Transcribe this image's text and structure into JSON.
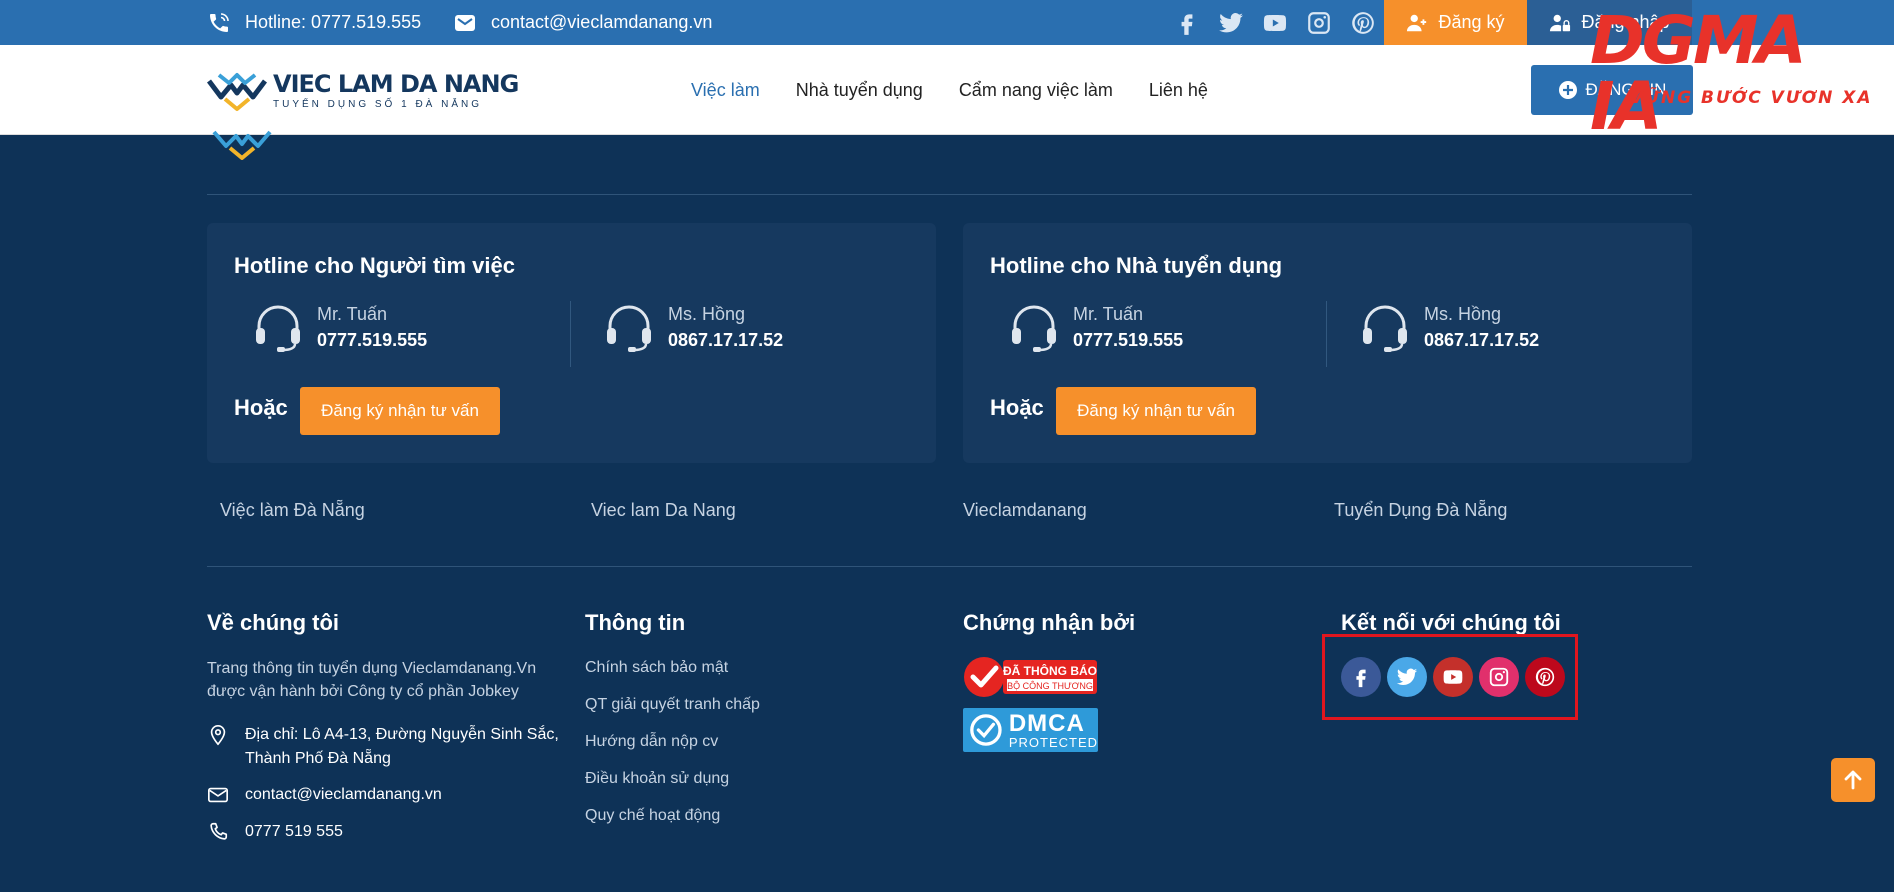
{
  "topbar": {
    "hotline": "Hotline: 0777.519.555",
    "email": "contact@vieclamdanang.vn",
    "social_icons": [
      "facebook-icon",
      "twitter-icon",
      "youtube-icon",
      "instagram-icon",
      "pinterest-icon"
    ],
    "register_label": "Đăng ký",
    "login_label": "Đăng nhập"
  },
  "header": {
    "logo_name": "VIEC LAM DA NANG",
    "logo_tagline": "TUYỂN DỤNG SỐ 1 ĐÀ NẴNG",
    "nav": [
      "Việc làm",
      "Nhà tuyển dụng",
      "Cẩm nang việc làm",
      "Liên hệ"
    ],
    "post_label": "ĐĂNG TIN"
  },
  "watermark": {
    "title": "DGMA IA",
    "slogan": "VỮNG BƯỚC VƯƠN XA"
  },
  "hotlines": [
    {
      "title": "Hotline cho Người tìm việc",
      "contacts": [
        {
          "name": "Mr. Tuấn",
          "phone": "0777.519.555"
        },
        {
          "name": "Ms. Hồng",
          "phone": "0867.17.17.52"
        }
      ],
      "or_label": "Hoặc",
      "cta_label": "Đăng ký nhận tư vấn"
    },
    {
      "title": "Hotline cho Nhà tuyển dụng",
      "contacts": [
        {
          "name": "Mr. Tuấn",
          "phone": "0777.519.555"
        },
        {
          "name": "Ms. Hồng",
          "phone": "0867.17.17.52"
        }
      ],
      "or_label": "Hoặc",
      "cta_label": "Đăng ký nhận tư vấn"
    }
  ],
  "keywords": [
    "Việc làm Đà Nẵng",
    "Viec lam Da Nang",
    "Vieclamdanang",
    "Tuyển Dụng Đà Nẵng"
  ],
  "about": {
    "title": "Về chúng tôi",
    "description": "Trang thông tin tuyển dụng Vieclamdanang.Vn được vận hành bởi Công ty cổ phần Jobkey",
    "address": "Địa chỉ: Lô A4-13, Đường Nguyễn Sinh Sắc, Thành Phố Đà Nẵng",
    "email": "contact@vieclamdanang.vn",
    "phone": "0777 519 555"
  },
  "info": {
    "title": "Thông tin",
    "links": [
      "Chính sách bảo mật",
      "QT giải quyết tranh chấp",
      "Hướng dẫn nộp cv",
      "Điều khoản sử dụng",
      "Quy chế hoạt động"
    ]
  },
  "certified": {
    "title": "Chứng nhận bởi",
    "badge1_line1": "ĐÃ THÔNG BÁO",
    "badge1_line2": "BỘ CÔNG THƯƠNG",
    "badge2_line1": "DMCA",
    "badge2_line2": "PROTECTED"
  },
  "connect": {
    "title": "Kết nối với chúng tôi",
    "icons": [
      "facebook-icon",
      "twitter-icon",
      "youtube-icon",
      "instagram-icon",
      "pinterest-icon"
    ],
    "colors": [
      "#3b5998",
      "#4aa8e8",
      "#c4302b",
      "#e1306c",
      "#bd081c"
    ],
    "highlight_color": "#e0161f"
  },
  "colors": {
    "topbar": "#2a6fb0",
    "accent": "#f6902b",
    "footer": "#0e3257",
    "card": "#16395f"
  }
}
